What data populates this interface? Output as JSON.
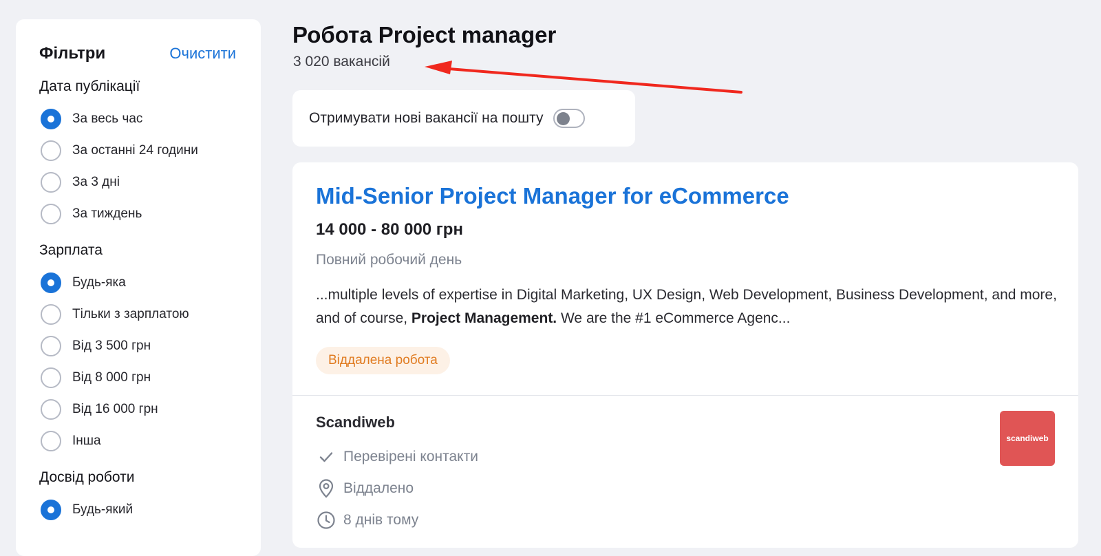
{
  "filters": {
    "title": "Фільтри",
    "clear_label": "Очистити",
    "groups": [
      {
        "title": "Дата публікації",
        "options": [
          "За весь час",
          "За останні 24 години",
          "За 3 дні",
          "За тиждень"
        ],
        "selected": "За весь час"
      },
      {
        "title": "Зарплата",
        "options": [
          "Будь-яка",
          "Тільки з зарплатою",
          "Від 3 500 грн",
          "Від 8 000 грн",
          "Від 16 000 грн",
          "Інша"
        ],
        "selected": "Будь-яка"
      },
      {
        "title": "Досвід роботи",
        "options": [
          "Будь-який"
        ],
        "selected": "Будь-який"
      }
    ]
  },
  "header": {
    "title": "Робота Project manager",
    "count": "3 020 вакансій"
  },
  "subscribe": {
    "label": "Отримувати нові вакансії на пошту",
    "enabled": false
  },
  "job": {
    "title": "Mid-Senior Project Manager for eCommerce",
    "salary": "14 000 - 80 000 грн",
    "employment": "Повний робочий день",
    "desc_before": " ...multiple levels of expertise in Digital Marketing, UX Design, Web Development, Business Development, and more, and of course, ",
    "desc_bold": "Project Management.",
    "desc_after": " We are the #1 eCommerce Agenc...",
    "tag": "Віддалена робота",
    "company": "Scandiweb",
    "verified": "Перевірені контакти",
    "location": "Віддалено",
    "posted": "8 днів тому",
    "logo_text": "scandiweb"
  },
  "colors": {
    "accent": "#1a73d8",
    "annotation_arrow": "#f0281e",
    "tag_text": "#e07b20",
    "logo_bg": "#e05555"
  }
}
